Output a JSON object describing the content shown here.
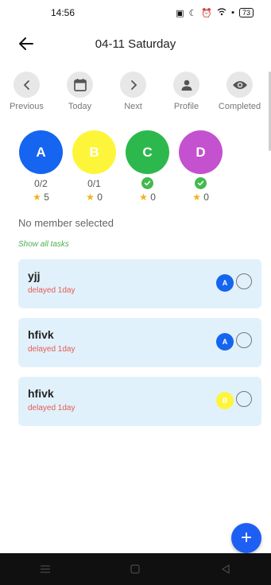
{
  "status_bar": {
    "time": "14:56",
    "battery": "73"
  },
  "header": {
    "date": "04-11 Saturday"
  },
  "toolbar": [
    {
      "label": "Previous",
      "icon": "chevron-left-icon"
    },
    {
      "label": "Today",
      "icon": "calendar-icon"
    },
    {
      "label": "Next",
      "icon": "chevron-right-icon"
    },
    {
      "label": "Profile",
      "icon": "person-icon"
    },
    {
      "label": "Completed",
      "icon": "eye-icon"
    }
  ],
  "members": [
    {
      "initial": "A",
      "color": "#1565f0",
      "progress": "0/2",
      "stars": "5",
      "done": false
    },
    {
      "initial": "B",
      "color": "#fdf53a",
      "progress": "0/1",
      "stars": "0",
      "done": false
    },
    {
      "initial": "C",
      "color": "#2db84d",
      "progress": "",
      "stars": "0",
      "done": true
    },
    {
      "initial": "D",
      "color": "#c451cf",
      "progress": "",
      "stars": "0",
      "done": true
    }
  ],
  "selection_text": "No member selected",
  "show_all_label": "Show all tasks",
  "tasks": [
    {
      "title": "yjj",
      "status": "delayed 1day",
      "assignee": "A",
      "assignee_color": "#1565f0"
    },
    {
      "title": "hfivk",
      "status": "delayed 1day",
      "assignee": "A",
      "assignee_color": "#1565f0"
    },
    {
      "title": "hfivk",
      "status": "delayed 1day",
      "assignee": "B",
      "assignee_color": "#fdf53a"
    }
  ],
  "fab_label": "+"
}
